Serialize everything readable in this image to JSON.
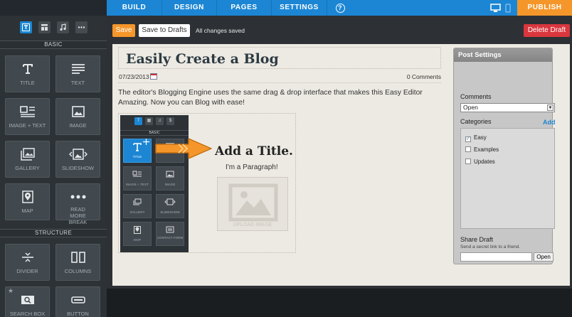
{
  "topnav": {
    "items": [
      "BUILD",
      "DESIGN",
      "PAGES",
      "SETTINGS"
    ],
    "help_icon": "question-circle-icon",
    "device_icons": [
      "desktop-icon",
      "mobile-icon"
    ],
    "publish": "PUBLISH"
  },
  "sidebar": {
    "tabs": [
      "text-icon",
      "layout-icon",
      "music-icon",
      "more-icon"
    ],
    "basic_title": "BASIC",
    "structure_title": "STRUCTURE",
    "tiles": {
      "title": "TITLE",
      "text": "TEXT",
      "image_text": "IMAGE + TEXT",
      "image": "IMAGE",
      "gallery": "GALLERY",
      "slideshow": "SLIDESHOW",
      "map": "MAP",
      "read_more": "READ MORE BREAK",
      "divider": "DIVIDER",
      "columns": "COLUMNS",
      "search_box": "SEARCH BOX",
      "button": "BUTTON"
    }
  },
  "toolbar": {
    "save": "Save",
    "save_drafts": "Save to Drafts",
    "status": "All changes saved",
    "delete_draft": "Delete Draft"
  },
  "post": {
    "title": "Easily Create a Blog",
    "date": "07/23/2013",
    "comments": "0 Comments",
    "body": "The editor's Blogging Engine uses the same drag & drop interface that makes this Easy Editor Amazing. Now you can Blog with ease!"
  },
  "illustration": {
    "mini_tabs": [
      "T",
      "▦",
      "♫",
      "$"
    ],
    "mini_section": "BASIC",
    "mini_tiles": [
      "TITLE",
      "IMAGE + TEXT",
      "IMAGE",
      "GALLERY",
      "SLIDESHOW",
      "MAP",
      "CONTACT FORM"
    ],
    "add_title": "Add a Title.",
    "paragraph": "I'm a Paragraph!",
    "upload": "UPLOAD IMAGE",
    "arrow_color": "#f5962a"
  },
  "post_settings": {
    "title": "Post Settings",
    "comments_label": "Comments",
    "comments_value": "Open",
    "categories_label": "Categories",
    "add": "Add",
    "categories": [
      {
        "name": "Easy",
        "checked": true
      },
      {
        "name": "Examples",
        "checked": false
      },
      {
        "name": "Updates",
        "checked": false
      }
    ],
    "share_label": "Share Draft",
    "share_hint": "Send a secret link to a friend.",
    "open_button": "Open"
  },
  "colors": {
    "accent_blue": "#1c86d4",
    "orange": "#f5962a",
    "delete_red": "#d9363e"
  }
}
